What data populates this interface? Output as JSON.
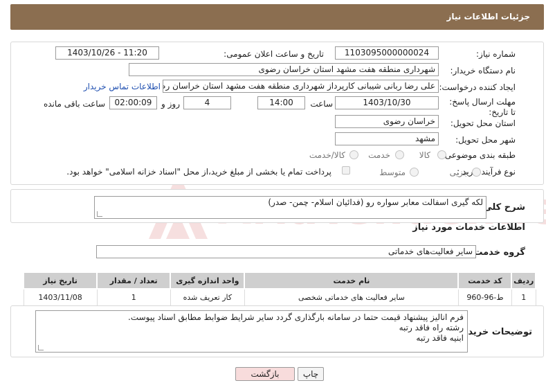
{
  "header": {
    "title": "جزئیات اطلاعات نیاز"
  },
  "form": {
    "need_number_label": "شماره نیاز:",
    "need_number": "1103095000000024",
    "announce_label": "تاریخ و ساعت اعلان عمومی:",
    "announce_value": "1403/10/26 - 11:20",
    "buyer_org_label": "نام دستگاه خریدار:",
    "buyer_org": "شهرداری منطقه هفت مشهد استان خراسان رضوی",
    "creator_label": "ایجاد کننده درخواست:",
    "creator": "علی رضا ربانی شیبانی کارپرداز شهرداری منطقه هفت مشهد استان خراسان رضوی",
    "contact_link": "اطلاعات تماس خریدار",
    "deadline_label": "مهلت ارسال پاسخ: تا تاریخ:",
    "deadline_date": "1403/10/30",
    "time_label": "ساعت",
    "deadline_time": "14:00",
    "days_value": "4",
    "days_label": "روز و",
    "remaining_time": "02:00:09",
    "remaining_label": "ساعت باقی مانده",
    "province_label": "استان محل تحویل:",
    "province": "خراسان رضوی",
    "city_label": "شهر محل تحویل:",
    "city": "مشهد",
    "category_label": "طبقه بندی موضوعی:",
    "category_options": [
      "کالا",
      "خدمت",
      "کالا/خدمت"
    ],
    "process_label": "نوع فرآیند خرید :",
    "process_options": [
      "جزیی",
      "متوسط"
    ],
    "payment_note": "پرداخت تمام یا بخشی از مبلغ خرید،از محل \"اسناد خزانه اسلامی\" خواهد بود."
  },
  "summary": {
    "label": "شرح کلی نیاز:",
    "text": "لکه گیری اسفالت معابر سواره رو (فدائیان اسلام- چمن- صدر)"
  },
  "services": {
    "section_title": "اطلاعات خدمات مورد نیاز",
    "group_label": "گروه خدمت:",
    "group_value": "سایر فعالیت‌های خدماتی",
    "columns": [
      "ردیف",
      "کد خدمت",
      "نام خدمت",
      "واحد اندازه گیری",
      "تعداد / مقدار",
      "تاریخ نیاز"
    ],
    "rows": [
      [
        "1",
        "ط-96-960",
        "سایر فعالیت های خدماتی شخصی",
        "کار تعریف شده",
        "1",
        "1403/11/08"
      ]
    ]
  },
  "buyer_notes": {
    "label": "توضیحات خریدار:",
    "lines": [
      "فرم انالیز پیشنهاد قیمت حتما در سامانه بارگذاری گردد سایر شرایط ضوابط مطابق اسناد پیوست.",
      "رشته راه فاقد رتبه",
      "ابنیه فاقد رتبه"
    ]
  },
  "buttons": {
    "print": "چاپ",
    "back": "بازگشت"
  },
  "watermark": {
    "text": "AriaTender.neT"
  },
  "colors": {
    "header_bg": "#8b6e50",
    "link": "#1f4fb0",
    "back_button_bg": "#f8dcdc"
  }
}
